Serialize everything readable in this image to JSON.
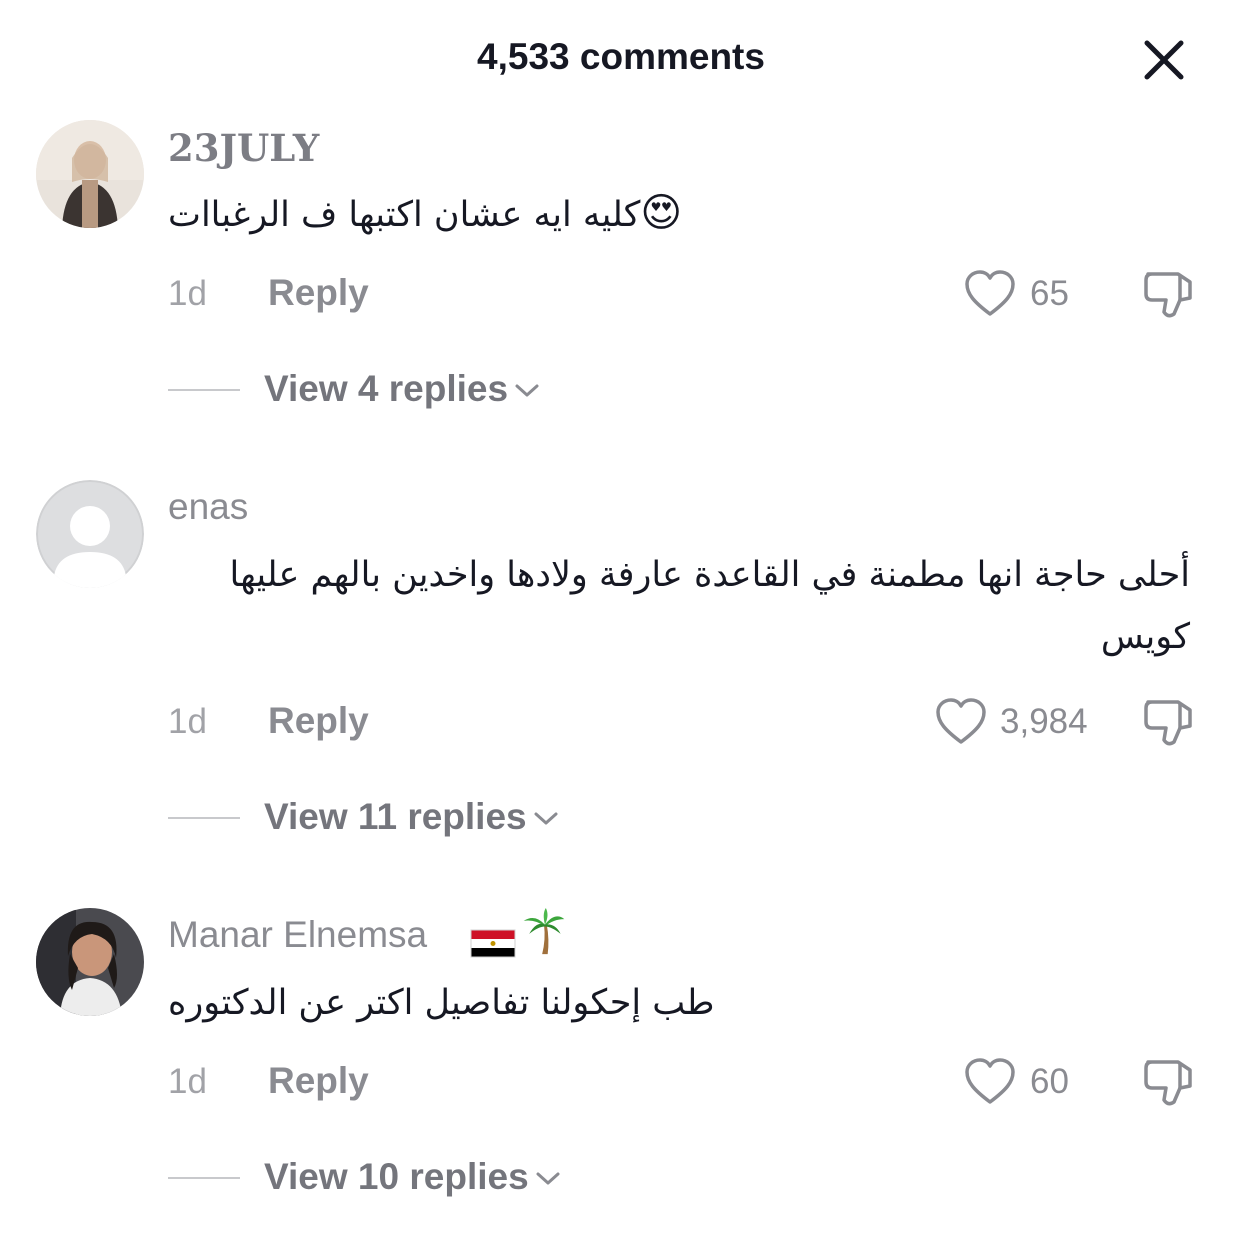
{
  "header": {
    "title": "4,533 comments"
  },
  "comments": [
    {
      "username": "23JULY",
      "text": "كليه ايه عشان اكتبها ف الرغباات",
      "emoji": "😍",
      "time": "1d",
      "reply_label": "Reply",
      "likes": "65",
      "view_replies": "View 4 replies"
    },
    {
      "username": "enas",
      "text": "أحلى حاجة انها مطمنة في القاعدة عارفة ولادها واخدين بالهم عليها كويس",
      "time": "1d",
      "reply_label": "Reply",
      "likes": "3,984",
      "view_replies": "View 11 replies"
    },
    {
      "username": "Manar Elnemsa",
      "username_icons": [
        "egypt-flag-icon",
        "palm-tree-icon"
      ],
      "text": "طب إحكولنا تفاصيل اكتر عن الدكتوره",
      "time": "1d",
      "reply_label": "Reply",
      "likes": "60",
      "view_replies": "View 10 replies"
    }
  ],
  "colors": {
    "text": "#161823",
    "secondary": "#8a8b91",
    "divider": "#c8c9cc"
  }
}
